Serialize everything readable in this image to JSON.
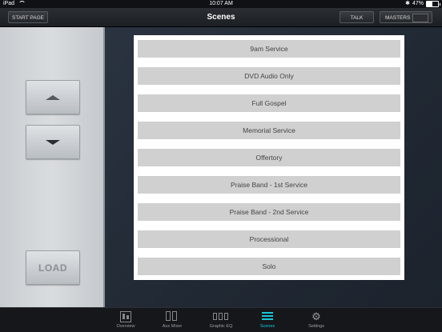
{
  "status_bar": {
    "device": "iPad",
    "time": "10:07 AM",
    "battery_percent": "47%",
    "battery_level": 0.47
  },
  "nav": {
    "start_page_label": "START PAGE",
    "title": "Scenes",
    "talk_label": "TALK",
    "masters_label": "MASTERS"
  },
  "left_panel": {
    "load_label": "LOAD"
  },
  "scenes": [
    "9am Service",
    "DVD Audio Only",
    "Full Gospel",
    "Memorial Service",
    "Offertory",
    "Praise Band - 1st Service",
    "Praise Band - 2nd Service",
    "Processional",
    "Solo"
  ],
  "tabs": [
    {
      "label": "Overview",
      "icon": "overview-icon"
    },
    {
      "label": "Aux Mixer",
      "icon": "aux-mixer-icon"
    },
    {
      "label": "Graphic EQ",
      "icon": "graphic-eq-icon"
    },
    {
      "label": "Scenes",
      "icon": "scenes-icon",
      "active": true
    },
    {
      "label": "Settings",
      "icon": "settings-icon"
    }
  ],
  "colors": {
    "accent": "#19c6d6",
    "scene_item_bg": "#d0d0d0"
  }
}
